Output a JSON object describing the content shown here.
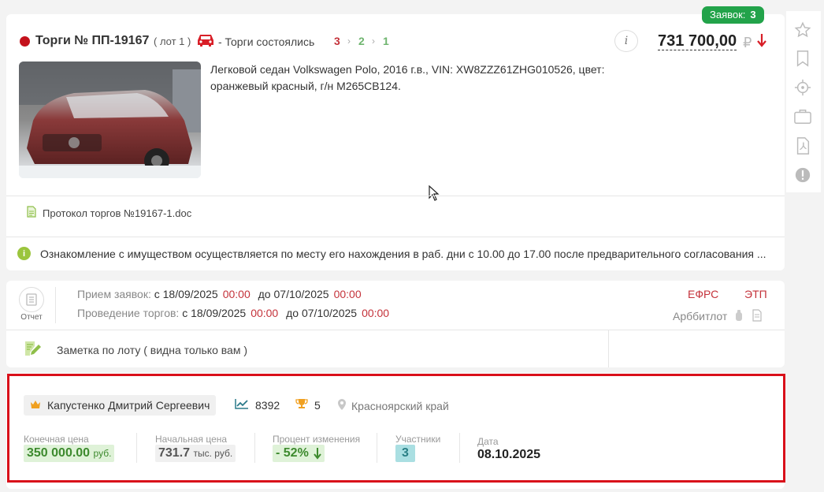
{
  "lot": {
    "title": "Торги № ПП-19167",
    "lot_number": "( лот 1 )",
    "status": "- Торги состоялись",
    "stages": [
      "3",
      "2",
      "1"
    ],
    "bids_label": "Заявок:",
    "bids_count": "3",
    "price": "731 700,00",
    "currency": "₽",
    "info_glyph": "i",
    "description": "Легковой седан Volkswagen Polo, 2016 г.в., VIN: XW8ZZZ61ZHG010526, цвет: оранжевый красный, г/н М265СВ124.",
    "document": "Протокол торгов №19167-1.doc",
    "notice": "Ознакомление с имуществом осуществляется по месту его нахождения в раб. дни с 10.00 до 17.00 после предварительного согласования ..."
  },
  "dates": {
    "report_label": "Отчет",
    "accept_label": "Прием заявок:",
    "accept_from_word": "с",
    "accept_from_date": "18/09/2025",
    "accept_from_time": "00:00",
    "accept_to_word": "до",
    "accept_to_date": "07/10/2025",
    "accept_to_time": "00:00",
    "auction_label": "Проведение торгов:",
    "auction_from_word": "с",
    "auction_from_date": "18/09/2025",
    "auction_from_time": "00:00",
    "auction_to_word": "до",
    "auction_to_date": "07/10/2025",
    "auction_to_time": "00:00",
    "efrs": "ЕФРС",
    "etp": "ЭТП",
    "platform": "Арббитлот",
    "note": "Заметка по лоту ( видна только вам )"
  },
  "winner": {
    "name": "Капустенко Дмитрий Сергеевич",
    "rating": "8392",
    "trophies": "5",
    "region": "Красноярский край",
    "final_price_label": "Конечная цена",
    "final_price": "350 000.00",
    "final_price_unit": "руб.",
    "start_price_label": "Начальная цена",
    "start_price": "731.7",
    "start_price_unit": "тыс. руб.",
    "change_label": "Процент изменения",
    "change": "- 52%",
    "participants_label": "Участники",
    "participants": "3",
    "date_label": "Дата",
    "date": "08.10.2025"
  },
  "colors": {
    "accent_red": "#c4121c",
    "green": "#22a34a",
    "highlight_border": "#d9101a"
  },
  "icons": [
    "star-icon",
    "bookmark-icon",
    "target-icon",
    "briefcase-icon",
    "pdf-icon",
    "alert-icon",
    "car-icon",
    "arrow-down-icon",
    "document-icon",
    "info-icon",
    "report-icon",
    "note-icon",
    "crown-icon",
    "chart-up-icon",
    "trophy-icon",
    "location-pin-icon"
  ]
}
